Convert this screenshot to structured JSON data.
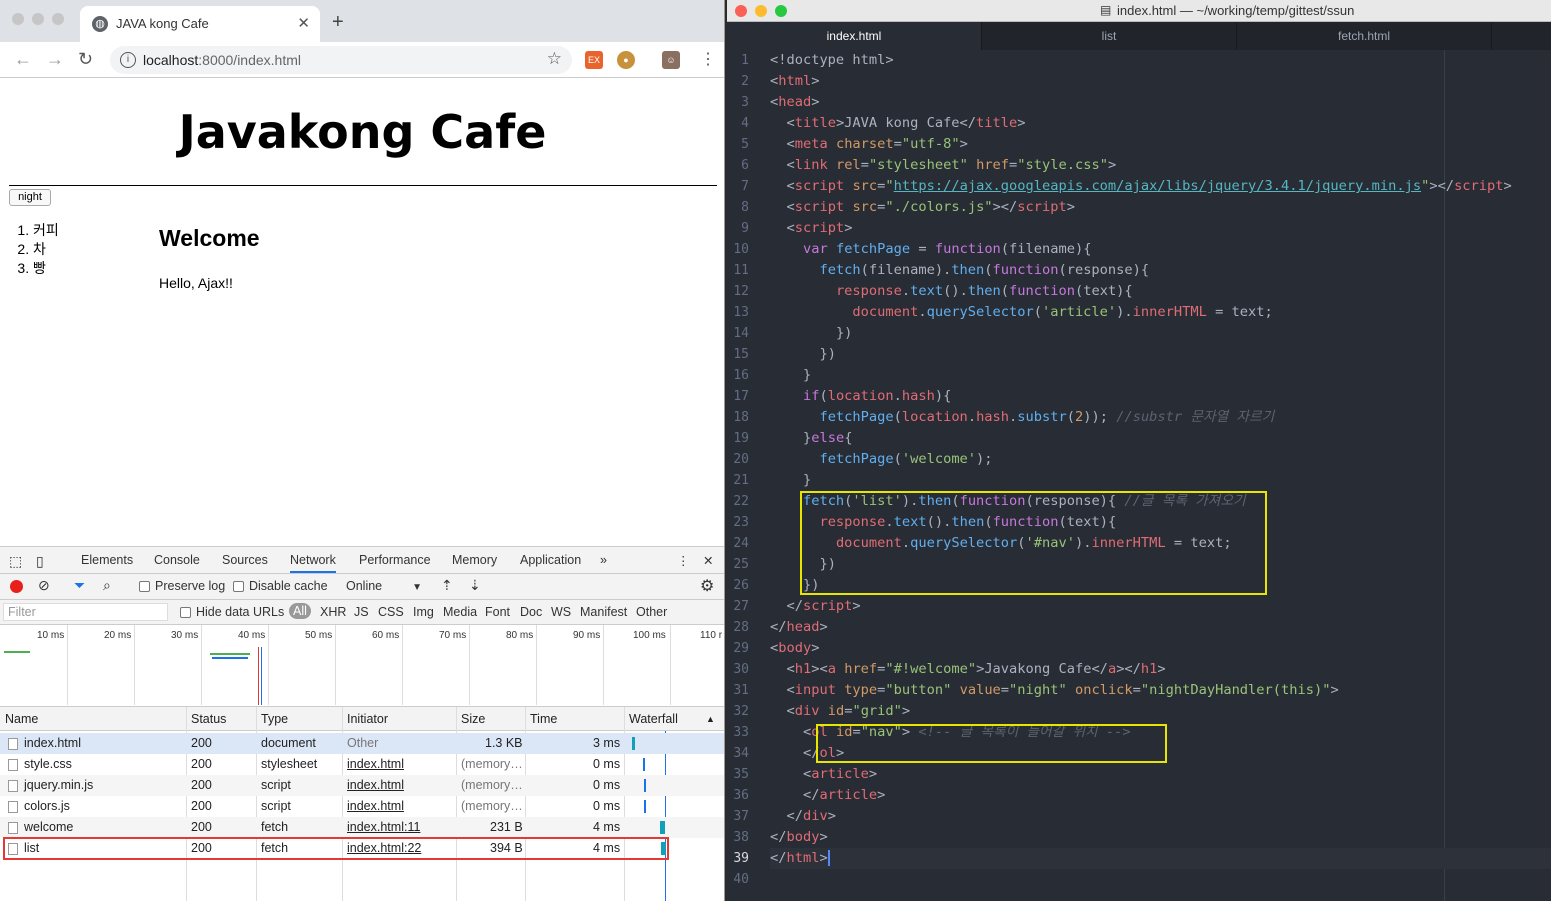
{
  "browser": {
    "tab_title": "JAVA kong Cafe",
    "url_host": "localhost",
    "url_rest": ":8000/index.html"
  },
  "page": {
    "heading": "Javakong Cafe",
    "night_button": "night",
    "nav_items": [
      "커피",
      "차",
      "빵"
    ],
    "article_title": "Welcome",
    "article_text": "Hello, Ajax!!"
  },
  "devtools": {
    "tabs": [
      "Elements",
      "Console",
      "Sources",
      "Network",
      "Performance",
      "Memory",
      "Application"
    ],
    "active_tab": "Network",
    "more": "»",
    "toolbar": {
      "preserve_log": "Preserve log",
      "disable_cache": "Disable cache",
      "throttle": "Online"
    },
    "filter": {
      "placeholder": "Filter",
      "hide_data_urls": "Hide data URLs",
      "types": [
        "All",
        "XHR",
        "JS",
        "CSS",
        "Img",
        "Media",
        "Font",
        "Doc",
        "WS",
        "Manifest",
        "Other"
      ]
    },
    "timeline_ticks": [
      "10 ms",
      "20 ms",
      "30 ms",
      "40 ms",
      "50 ms",
      "60 ms",
      "70 ms",
      "80 ms",
      "90 ms",
      "100 ms",
      "110 r"
    ],
    "columns": [
      "Name",
      "Status",
      "Type",
      "Initiator",
      "Size",
      "Time",
      "Waterfall"
    ],
    "rows": [
      {
        "name": "index.html",
        "status": "200",
        "type": "document",
        "initiator": "Other",
        "size": "1.3 KB",
        "time": "3 ms"
      },
      {
        "name": "style.css",
        "status": "200",
        "type": "stylesheet",
        "initiator": "index.html",
        "size": "(memory…",
        "time": "0 ms"
      },
      {
        "name": "jquery.min.js",
        "status": "200",
        "type": "script",
        "initiator": "index.html",
        "size": "(memory…",
        "time": "0 ms"
      },
      {
        "name": "colors.js",
        "status": "200",
        "type": "script",
        "initiator": "index.html",
        "size": "(memory…",
        "time": "0 ms"
      },
      {
        "name": "welcome",
        "status": "200",
        "type": "fetch",
        "initiator": "index.html:11",
        "size": "231 B",
        "time": "4 ms"
      },
      {
        "name": "list",
        "status": "200",
        "type": "fetch",
        "initiator": "index.html:22",
        "size": "394 B",
        "time": "4 ms"
      }
    ]
  },
  "editor": {
    "title": "index.html — ~/working/temp/gittest/ssun",
    "tabs": [
      "index.html",
      "list",
      "fetch.html"
    ],
    "line_numbers": [
      "1",
      "2",
      "3",
      "4",
      "5",
      "6",
      "7",
      "8",
      "9",
      "10",
      "11",
      "12",
      "13",
      "14",
      "15",
      "16",
      "17",
      "18",
      "19",
      "20",
      "21",
      "22",
      "23",
      "24",
      "25",
      "26",
      "27",
      "28",
      "29",
      "30",
      "31",
      "32",
      "33",
      "34",
      "35",
      "36",
      "37",
      "38",
      "39",
      "40"
    ]
  },
  "colors": {
    "highlight_box": "#e6e600",
    "red_box": "#e53935",
    "accent": "#1a73e8"
  }
}
